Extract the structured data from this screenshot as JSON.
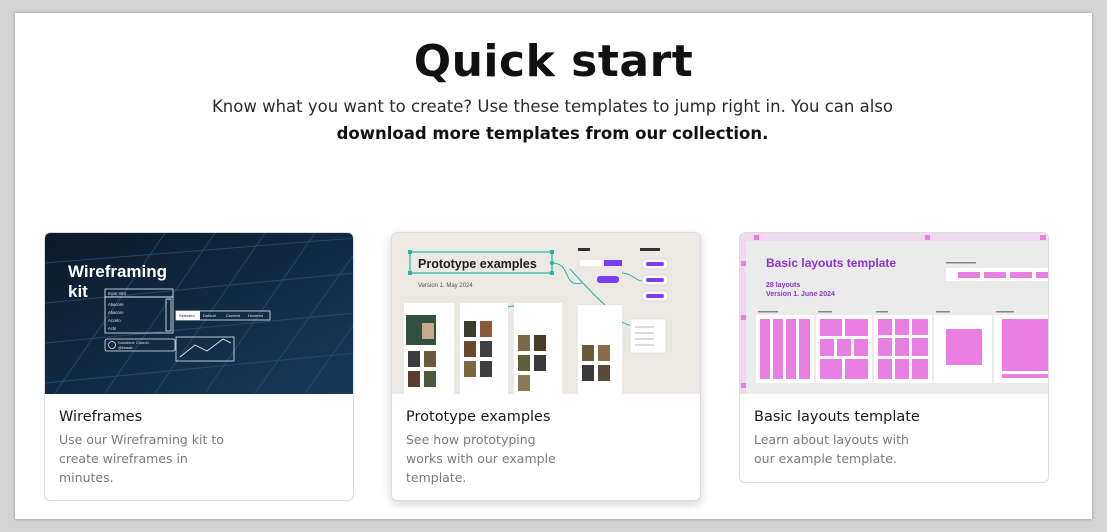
{
  "heading": "Quick start",
  "intro": {
    "text": "Know what you want to create? Use these templates to jump right in. You can also ",
    "link": "download more templates from our collection."
  },
  "cards": [
    {
      "title": "Wireframes",
      "description": "Use our Wireframing kit to create wireframes in minutes.",
      "thumb": {
        "heading_line1": "Wireframing",
        "heading_line2": "kit",
        "input_label": "Input Hint",
        "list_items": [
          "Abacore",
          "Abacore",
          "Accelo",
          "Acts"
        ],
        "tabs": [
          "Selected",
          "Default",
          "Content",
          "Hovered"
        ],
        "author_name": "Sunshine Church",
        "author_handle": "@Mosaic"
      }
    },
    {
      "title": "Prototype examples",
      "description": "See how prototyping works with our example template.",
      "thumb": {
        "heading": "Prototype examples",
        "version": "Version 1. May 2024"
      }
    },
    {
      "title": "Basic layouts template",
      "description": "Learn about layouts with our example template.",
      "thumb": {
        "heading": "Basic layouts template",
        "count": "28 layouts",
        "version": "Version 1. June 2024"
      }
    }
  ],
  "colors": {
    "wire_bg": "#0e2236",
    "proto_bg": "#ece8e4",
    "proto_accent": "#28b5a5",
    "proto_button": "#7b3ff2",
    "layout_bg": "#ebebeb",
    "layout_pink": "#e97ee3",
    "layout_heading": "#8a35c8"
  }
}
